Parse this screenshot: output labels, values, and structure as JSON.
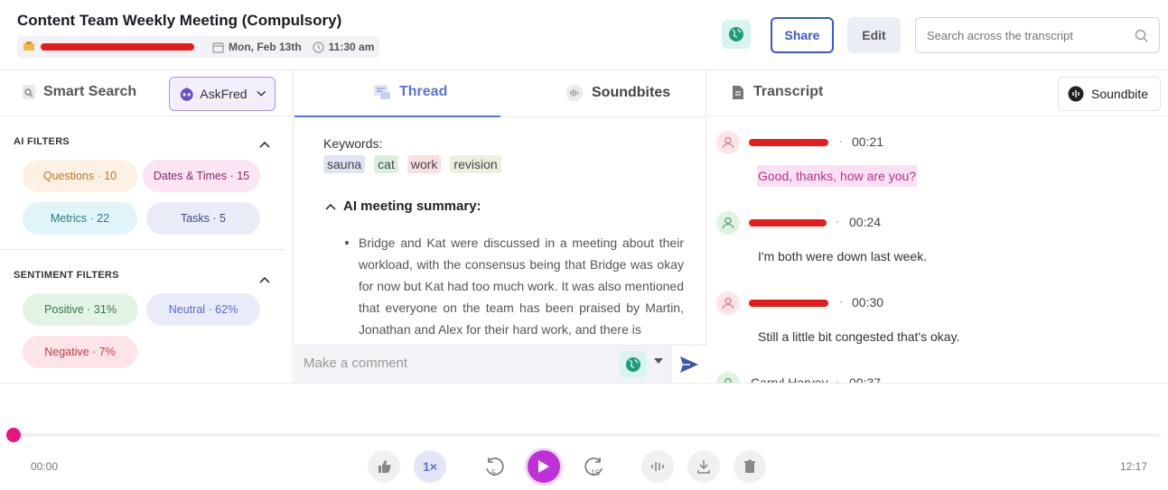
{
  "header": {
    "title": "Content Team Weekly Meeting (Compulsory)",
    "date": "Mon, Feb 13th",
    "time": "11:30 am",
    "share_label": "Share",
    "edit_label": "Edit",
    "search_placeholder": "Search across the transcript"
  },
  "left": {
    "smart_search": "Smart Search",
    "askfred": "AskFred",
    "ai_filters_title": "AI FILTERS",
    "ai_filters": [
      {
        "label": "Questions · 10",
        "color": "#fdf1e4",
        "text": "#c0772a"
      },
      {
        "label": "Dates & Times · 15",
        "color": "#fbe4f4",
        "text": "#8a2c6a"
      },
      {
        "label": "Metrics · 22",
        "color": "#dff5f7",
        "text": "#2c7a84"
      },
      {
        "label": "Tasks · 5",
        "color": "#e9ebf7",
        "text": "#3d4a8c"
      }
    ],
    "sentiment_title": "SENTIMENT FILTERS",
    "sentiment_filters": [
      {
        "label": "Positive · 31%",
        "color": "#e3f4e7",
        "text": "#2f7d45"
      },
      {
        "label": "Neutral · 62%",
        "color": "#e9ebf9",
        "text": "#5a6bd6"
      },
      {
        "label": "Negative · 7%",
        "color": "#fde4e6",
        "text": "#c43a4a"
      }
    ]
  },
  "middle": {
    "tabs": [
      {
        "label": "Thread",
        "active": true
      },
      {
        "label": "Soundbites",
        "active": false
      }
    ],
    "keywords_label": "Keywords:",
    "keywords": [
      {
        "text": "sauna",
        "color": "#dfe3f2"
      },
      {
        "text": "cat",
        "color": "#d9f0e1"
      },
      {
        "text": "work",
        "color": "#fbe0e2"
      },
      {
        "text": "revision",
        "color": "#eeeedf"
      }
    ],
    "summary_title": "AI meeting summary:",
    "summary_text": "Bridge and Kat were discussed in a meeting about their workload, with the consensus being that Bridge was okay for now but Kat had too much work. It was also mentioned that everyone on the team has been praised by Martin, Jonathan and Alex for their hard work, and there is",
    "comment_placeholder": "Make a comment"
  },
  "right": {
    "title": "Transcript",
    "soundbite_label": "Soundbite",
    "entries": [
      {
        "time": "00:21",
        "text": "Good, thanks, how are you?",
        "avatar_bg": "#fde4e6",
        "avatar_color": "#e07a86",
        "highlight": "#fbe0f4",
        "text_color": "#b0358a"
      },
      {
        "time": "00:24",
        "text": "I'm both were down last week.",
        "avatar_bg": "#dff2e4",
        "avatar_color": "#5aa56c",
        "highlight": "",
        "text_color": "#333"
      },
      {
        "time": "00:30",
        "text": "Still a little bit congested that's okay.",
        "avatar_bg": "#fde4e6",
        "avatar_color": "#e07a86",
        "highlight": "",
        "text_color": "#333"
      },
      {
        "time": "00:37",
        "speaker": "Carryl Harvey",
        "text": "",
        "avatar_bg": "#dff2e4",
        "avatar_color": "#5aa56c",
        "highlight": "",
        "text_color": "#333"
      }
    ]
  },
  "player": {
    "current_time": "00:00",
    "total_time": "12:17",
    "speed": "1×",
    "rewind_seconds": "5",
    "forward_seconds": "15",
    "progress": 0
  }
}
